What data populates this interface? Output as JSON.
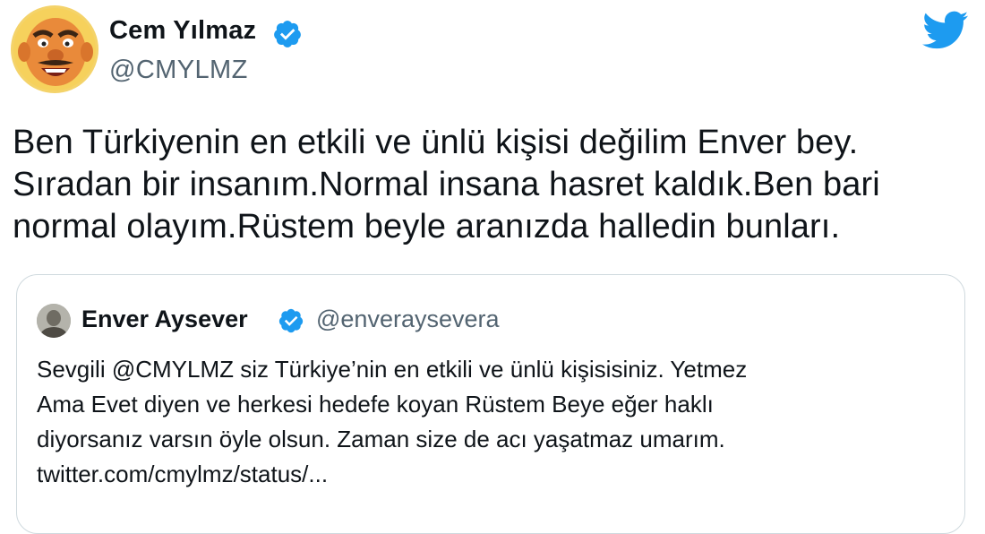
{
  "tweet": {
    "author": {
      "name": "Cem Yılmaz",
      "handle": "@CMYLMZ",
      "verified": true,
      "avatar_icon": "cartoon-avatar"
    },
    "text_lines": [
      "Ben Türkiyenin en etkili ve ünlü kişisi değilim Enver bey.",
      "Sıradan bir insanım.Normal insana hasret kaldık.Ben bari",
      "normal olayım.Rüstem beyle aranızda halledin bunları."
    ],
    "logo_icon": "twitter-bird-icon"
  },
  "quoted_tweet": {
    "author": {
      "name": "Enver Aysever",
      "handle": "@enveraysevera",
      "verified": true
    },
    "text_lines": [
      "Sevgili @CMYLMZ siz Türkiye’nin en etkili ve ünlü kişisisiniz. Yetmez",
      "Ama Evet diyen ve herkesi hedefe koyan Rüstem Beye eğer haklı",
      "diyorsanız varsın öyle olsun. Zaman size de acı yaşatmaz umarım.",
      "twitter.com/cmylmz/status/..."
    ]
  },
  "colors": {
    "verified_blue": "#1d9bf0",
    "twitter_blue": "#1d9bf0",
    "secondary_text": "#536471",
    "border": "#cfd9de"
  }
}
